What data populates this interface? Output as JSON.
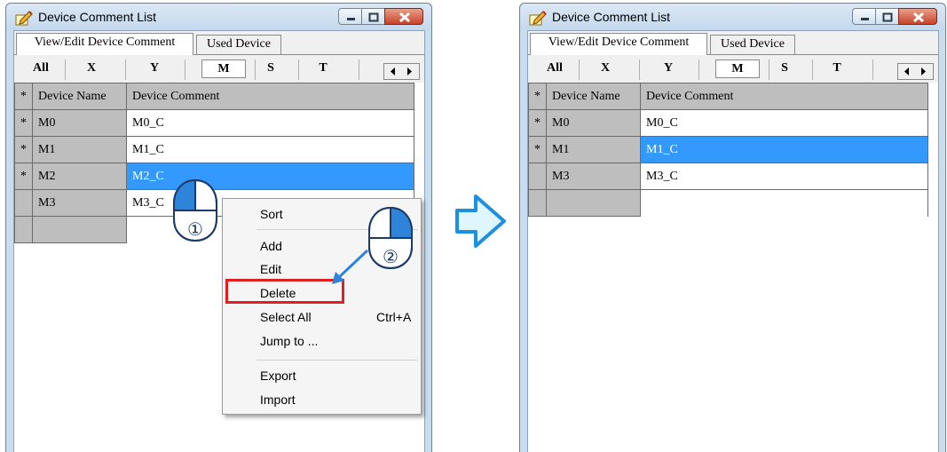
{
  "left_window": {
    "title": "Device Comment List",
    "tabs": [
      "View/Edit Device Comment",
      "Used Device"
    ],
    "device_types": [
      "All",
      "X",
      "Y",
      "M",
      "S",
      "T"
    ],
    "selected_device_type": "M",
    "grid": {
      "headers": [
        "*",
        "Device Name",
        "Device Comment"
      ],
      "rows": [
        {
          "marker": "*",
          "name": "M0",
          "comment": "M0_C",
          "selected": false
        },
        {
          "marker": "*",
          "name": "M1",
          "comment": "M1_C",
          "selected": false
        },
        {
          "marker": "*",
          "name": "M2",
          "comment": "M2_C",
          "selected": true
        },
        {
          "marker": "",
          "name": "M3",
          "comment": "M3_C",
          "selected": false
        }
      ]
    },
    "context_menu": {
      "items": [
        "Sort",
        "Add",
        "Edit",
        "Delete",
        "Select All",
        "Jump to ...",
        "Export",
        "Import"
      ],
      "select_all_shortcut": "Ctrl+A",
      "highlighted_item": "Delete"
    },
    "step_markers": [
      "①",
      "②"
    ]
  },
  "right_window": {
    "title": "Device Comment List",
    "tabs": [
      "View/Edit Device Comment",
      "Used Device"
    ],
    "device_types": [
      "All",
      "X",
      "Y",
      "M",
      "S",
      "T"
    ],
    "selected_device_type": "M",
    "grid": {
      "headers": [
        "*",
        "Device Name",
        "Device Comment"
      ],
      "rows": [
        {
          "marker": "*",
          "name": "M0",
          "comment": "M0_C",
          "selected": false
        },
        {
          "marker": "*",
          "name": "M1",
          "comment": "M1_C",
          "selected": true
        },
        {
          "marker": "",
          "name": "M3",
          "comment": "M3_C",
          "selected": false
        }
      ]
    }
  },
  "colors": {
    "selection": "#3399ff",
    "grid_header": "#bebebe",
    "delete_highlight": "#e02020",
    "arrow_fill": "#dff6ff",
    "arrow_stroke": "#1e90e0"
  }
}
